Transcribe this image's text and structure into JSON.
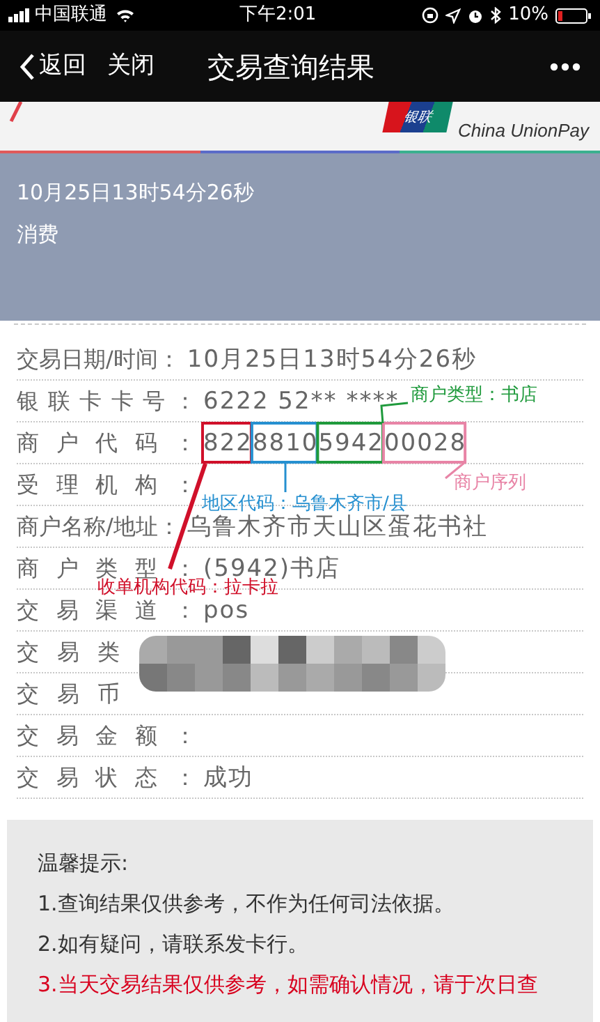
{
  "status_bar": {
    "carrier": "中国联通",
    "time": "下午2:01",
    "battery": "10%"
  },
  "nav_bar": {
    "back": "返回",
    "close": "关闭",
    "title": "交易查询结果"
  },
  "header": {
    "logo": {
      "badge": "银联",
      "english": "China UnionPay"
    }
  },
  "summary": {
    "time": "10月25日13时54分26秒",
    "type": "消费"
  },
  "details": [
    {
      "label": "交易日期/时间：",
      "value": "10月25日13时54分26秒"
    },
    {
      "label": "银联卡卡号：",
      "value": "6222 52** ****"
    },
    {
      "label": "商户代码：",
      "value": "8228810594200028"
    },
    {
      "label": "受理机构："
    },
    {
      "label": "商户名称/地址：",
      "value": "乌鲁木齐市天山区蛋花书社"
    },
    {
      "label": "商户类型：",
      "value": "(5942)书店"
    },
    {
      "label": "交易渠道：",
      "value": "pos"
    },
    {
      "label": "交易类"
    },
    {
      "label": "交易币"
    },
    {
      "label": "交易金额："
    },
    {
      "label": "交易状态：",
      "value": "成功"
    }
  ],
  "annotations": [
    {
      "text": "商户类型：书店",
      "color": "#1f9a3c"
    },
    {
      "text": "商户序列",
      "color": "#e884a6"
    },
    {
      "text": "地区代码：乌鲁木齐市/县",
      "color": "#2690d0"
    },
    {
      "text": "收单机构代码：拉卡拉",
      "color": "#d0102a"
    }
  ],
  "tips": {
    "title": "温馨提示:",
    "items": [
      {
        "text": "1.查询结果仅供参考，不作为任何司法依据。",
        "warning": false
      },
      {
        "text": "2.如有疑问，请联系发卡行。",
        "warning": false
      },
      {
        "text": "3.当天交易结果仅供参考，如需确认情况，请于次日查",
        "warning": true
      }
    ]
  }
}
